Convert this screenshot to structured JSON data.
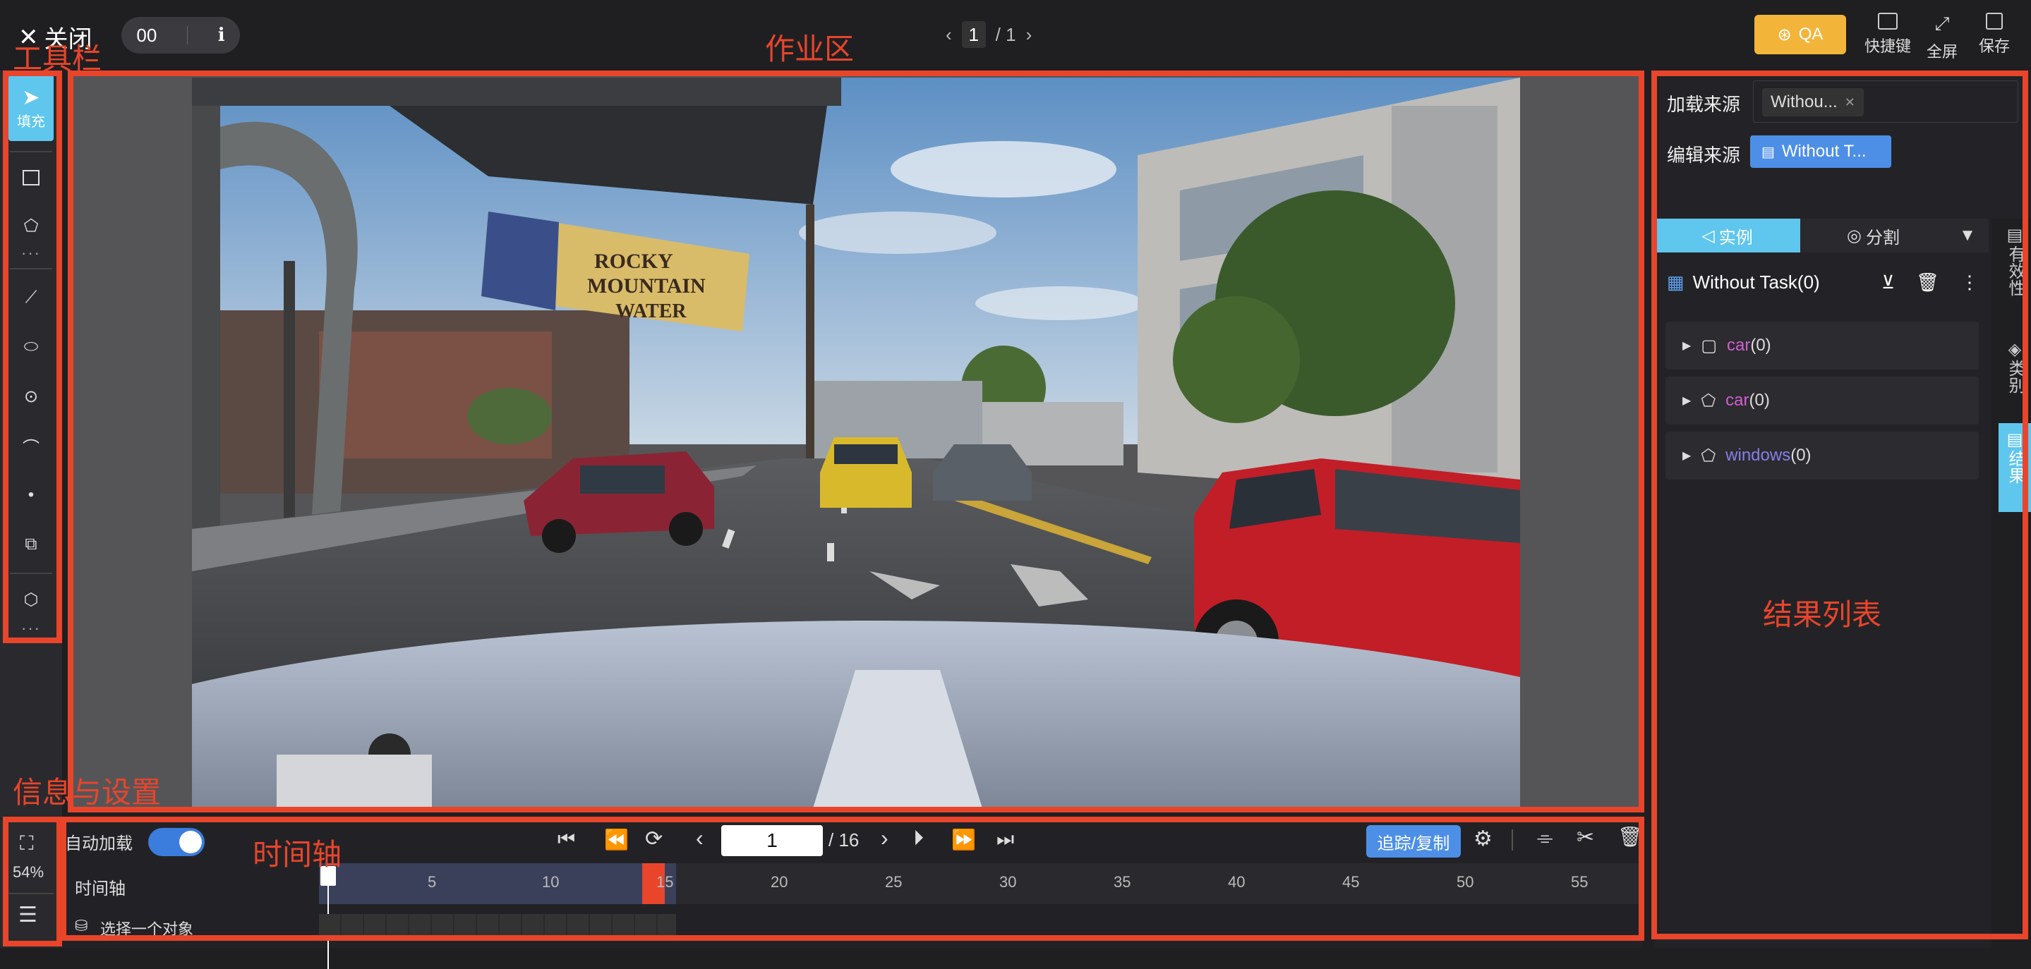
{
  "topbar": {
    "close_label": "关闭",
    "counter": "00",
    "page_current": "1",
    "page_total": "/ 1",
    "qa_label": "QA",
    "shortcuts_label": "快捷键",
    "fullscreen_label": "全屏",
    "save_label": "保存"
  },
  "annotations": {
    "toolbar": "工具栏",
    "workspace": "作业区",
    "info_settings": "信息与设置",
    "timeline": "时间轴",
    "result_list": "结果列表"
  },
  "toolbar": {
    "active_tool_label": "填充",
    "tools": [
      "rect-tool-icon",
      "polygon-tool-icon",
      "line-tool-icon",
      "ellipse-tool-icon",
      "circle-tool-icon",
      "curve-tool-icon",
      "point-tool-icon",
      "cuboid-tool-icon",
      "ai-tool-icon"
    ]
  },
  "info_settings": {
    "zoom": "54%"
  },
  "timeline": {
    "auto_load_label": "自动加载",
    "auto_load_on": true,
    "frame_value": "1",
    "frame_total": "/ 16",
    "track_copy_label": "追踪/复制",
    "row_label": "时间轴",
    "select_object_label": "选择一个对象",
    "ticks": [
      "5",
      "10",
      "15",
      "20",
      "25",
      "30",
      "35",
      "40",
      "45",
      "50",
      "55"
    ],
    "current_frame": 15
  },
  "right_panel": {
    "load_source_label": "加载来源",
    "load_source_tag": "Withou...",
    "edit_source_label": "编辑来源",
    "edit_source_tag": "Without T...",
    "tab_instance": "实例",
    "tab_segment": "分割",
    "task_title": "Without Task(0)",
    "groups": [
      {
        "name": "car",
        "count": "(0)",
        "color": "#d060d0",
        "icon": "rect-icon"
      },
      {
        "name": "car",
        "count": "(0)",
        "color": "#d060d0",
        "icon": "polygon-icon"
      },
      {
        "name": "windows",
        "count": "(0)",
        "color": "#8a7ee8",
        "icon": "polygon-icon"
      }
    ],
    "side_tabs": [
      "有效性",
      "类别",
      "结果"
    ]
  }
}
